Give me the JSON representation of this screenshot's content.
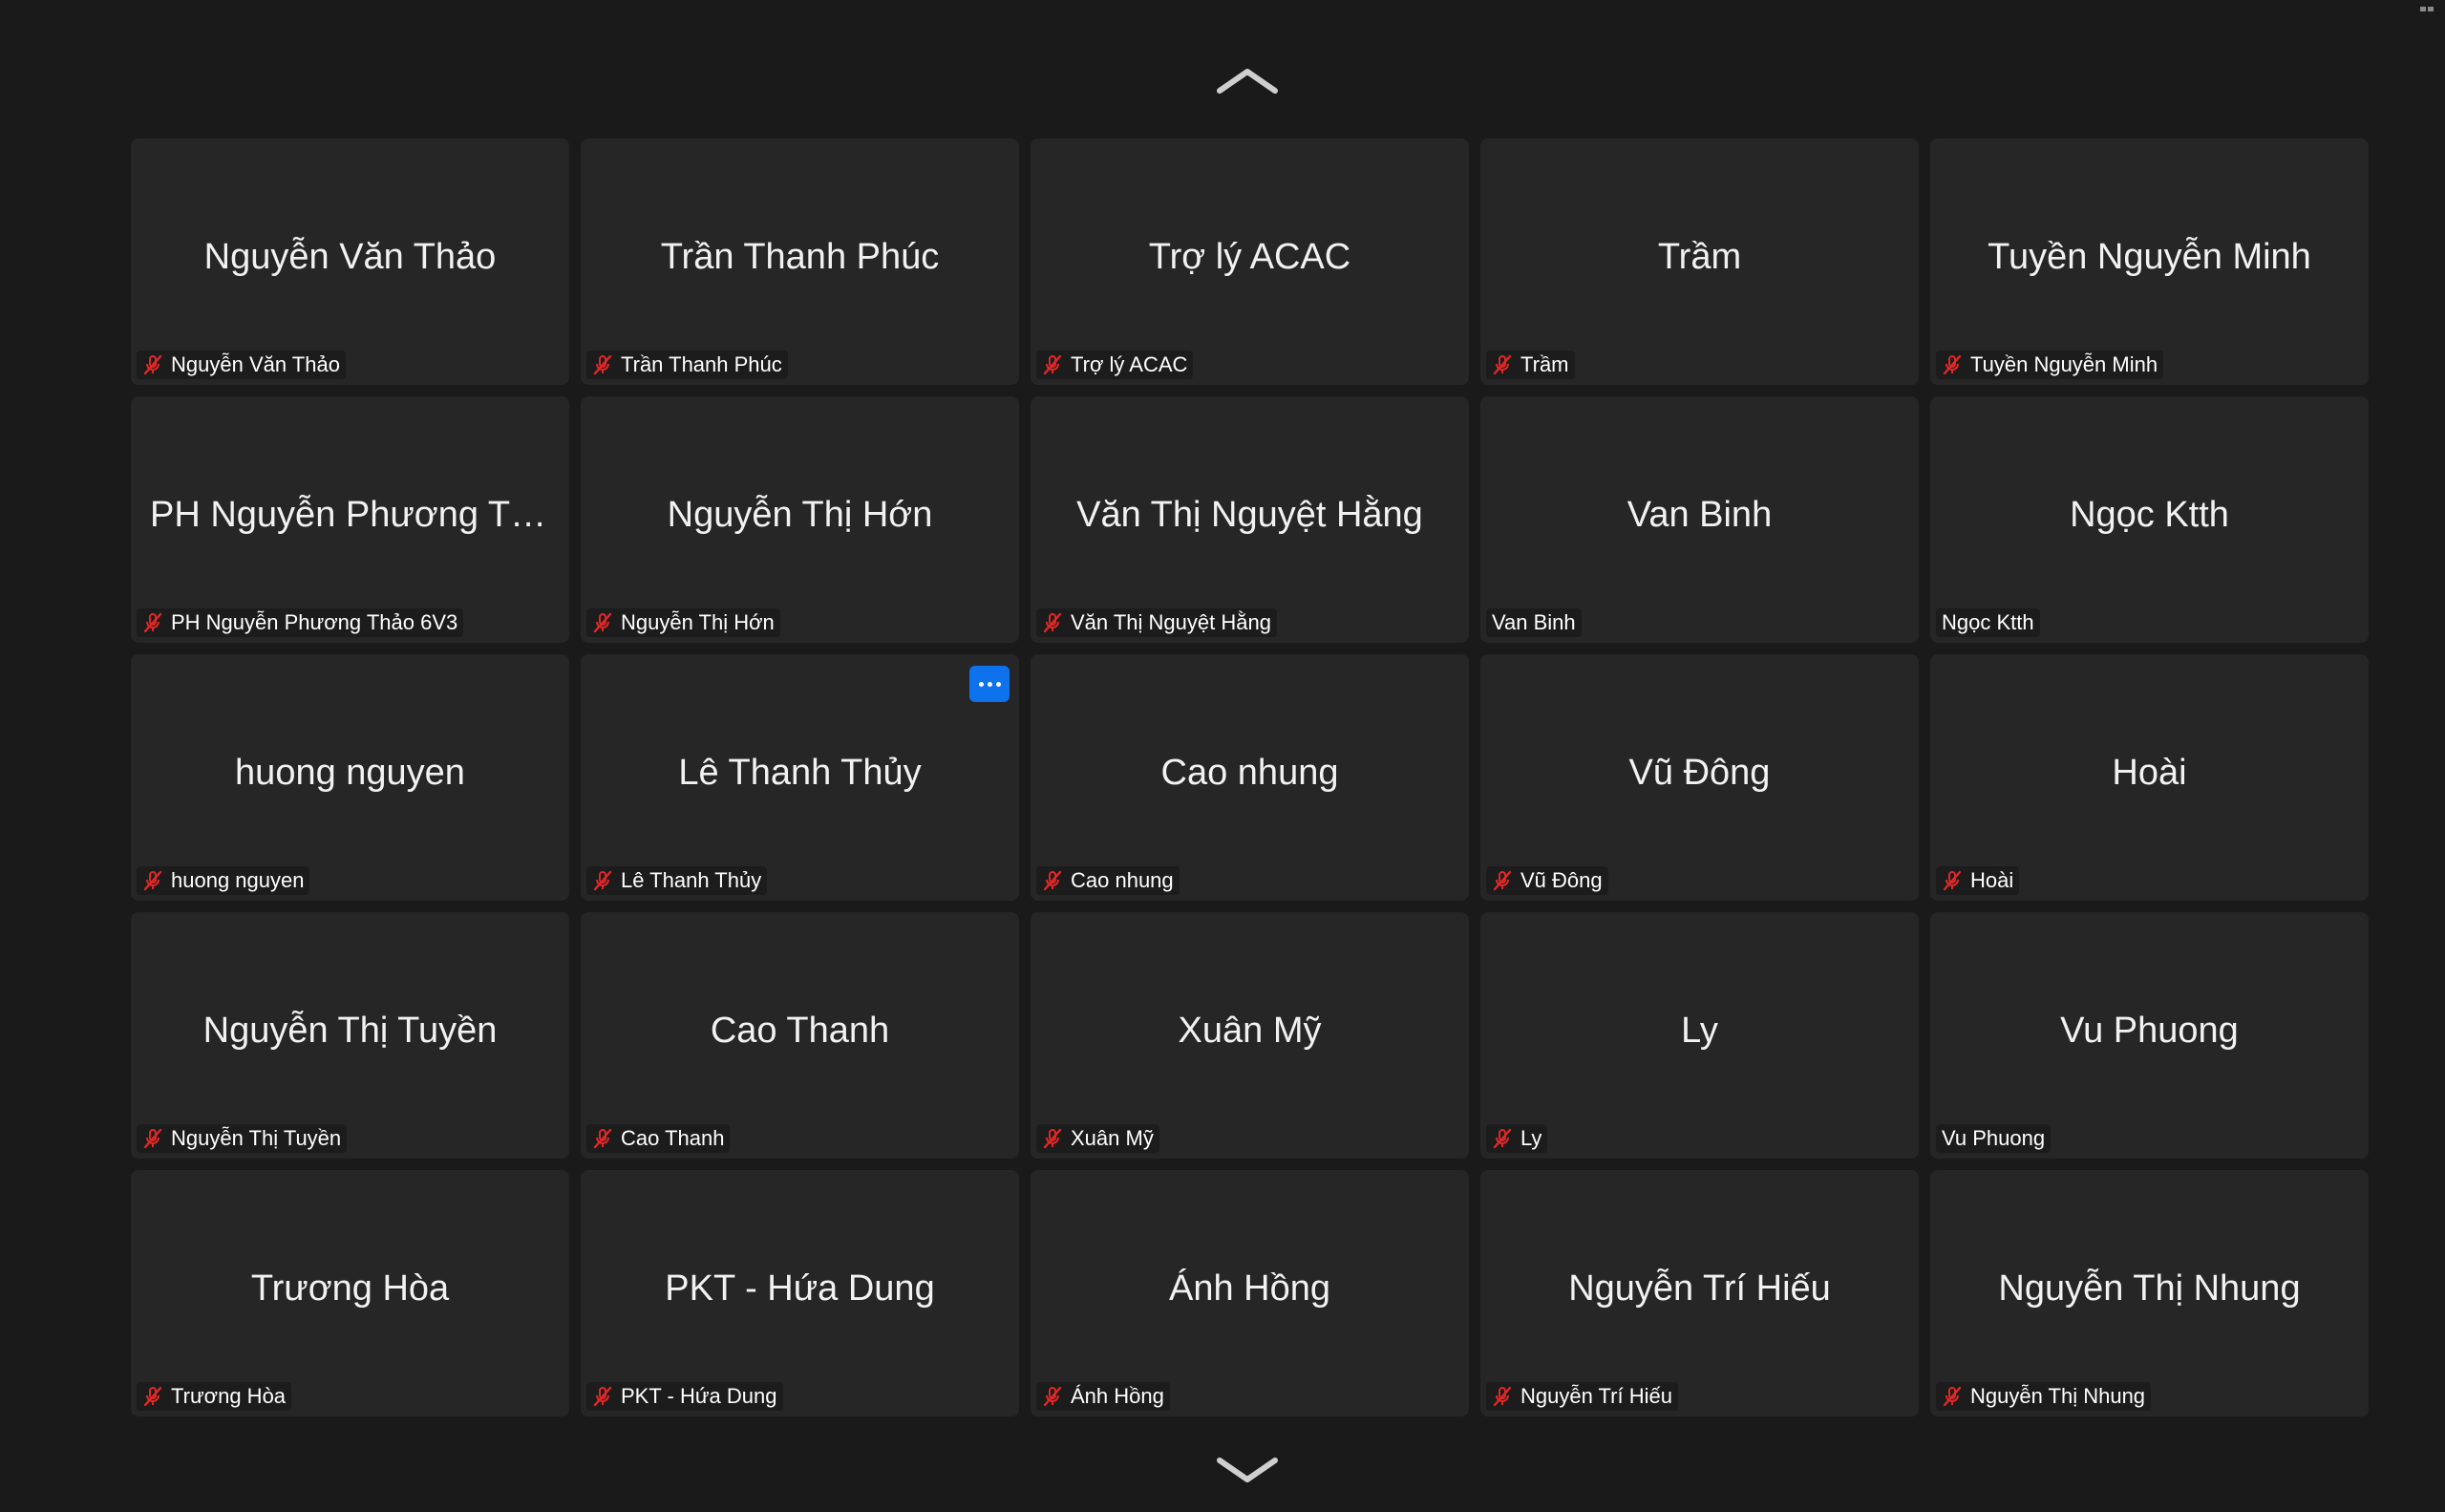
{
  "navigation": {
    "up_icon": "chevron-up-icon",
    "down_icon": "chevron-down-icon"
  },
  "colors": {
    "background": "#1a1a1a",
    "tile": "#262626",
    "muted_mic": "#e02828",
    "more_button": "#0e72ed"
  },
  "participants": [
    {
      "display_name": "Nguyễn Văn Thảo",
      "label": "Nguyễn Văn Thảo",
      "muted": true
    },
    {
      "display_name": "Trần Thanh Phúc",
      "label": "Trần Thanh Phúc",
      "muted": true
    },
    {
      "display_name": "Trợ lý ACAC",
      "label": "Trợ lý ACAC",
      "muted": true
    },
    {
      "display_name": "Trầm",
      "label": "Trầm",
      "muted": true
    },
    {
      "display_name": "Tuyền Nguyễn Minh",
      "label": "Tuyền Nguyễn Minh",
      "muted": true
    },
    {
      "display_name": "PH Nguyễn Phương Thả...",
      "label": "PH Nguyễn Phương Thảo 6V3",
      "muted": true
    },
    {
      "display_name": "Nguyễn Thị Hớn",
      "label": "Nguyễn Thị Hớn",
      "muted": true
    },
    {
      "display_name": "Văn Thị Nguyệt Hằng",
      "label": "Văn Thị Nguyệt Hằng",
      "muted": true
    },
    {
      "display_name": "Van Binh",
      "label": "Van Binh",
      "muted": false
    },
    {
      "display_name": "Ngọc Ktth",
      "label": "Ngọc Ktth",
      "muted": false
    },
    {
      "display_name": "huong nguyen",
      "label": "huong nguyen",
      "muted": true
    },
    {
      "display_name": "Lê Thanh Thủy",
      "label": "Lê Thanh Thủy",
      "muted": true,
      "more_button": "more-options-icon"
    },
    {
      "display_name": "Cao nhung",
      "label": "Cao nhung",
      "muted": true
    },
    {
      "display_name": "Vũ Đông",
      "label": "Vũ Đông",
      "muted": true
    },
    {
      "display_name": "Hoài",
      "label": "Hoài",
      "muted": true
    },
    {
      "display_name": "Nguyễn Thị Tuyền",
      "label": "Nguyễn Thị Tuyền",
      "muted": true
    },
    {
      "display_name": "Cao Thanh",
      "label": "Cao Thanh",
      "muted": true
    },
    {
      "display_name": "Xuân Mỹ",
      "label": "Xuân Mỹ",
      "muted": true
    },
    {
      "display_name": "Ly",
      "label": "Ly",
      "muted": true
    },
    {
      "display_name": "Vu Phuong",
      "label": "Vu Phuong",
      "muted": false
    },
    {
      "display_name": "Trương Hòa",
      "label": "Trương Hòa",
      "muted": true
    },
    {
      "display_name": "PKT - Hứa Dung",
      "label": "PKT - Hứa Dung",
      "muted": true
    },
    {
      "display_name": "Ánh Hồng",
      "label": "Ánh Hồng",
      "muted": true
    },
    {
      "display_name": "Nguyễn Trí Hiếu",
      "label": "Nguyễn Trí Hiếu",
      "muted": true
    },
    {
      "display_name": "Nguyễn Thị Nhung",
      "label": "Nguyễn Thị Nhung",
      "muted": true
    }
  ]
}
